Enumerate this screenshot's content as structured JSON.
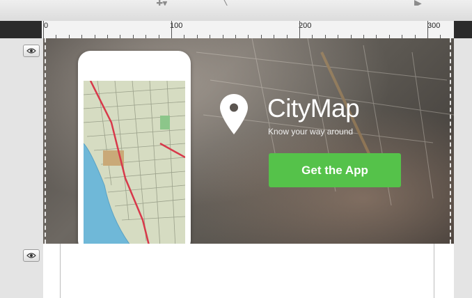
{
  "ruler": {
    "labels": [
      "0",
      "100",
      "200",
      "300"
    ]
  },
  "layers": [
    {
      "visibility_icon": "eye-icon"
    },
    {
      "visibility_icon": "eye-icon"
    }
  ],
  "banner": {
    "app_name": "CityMap",
    "tagline": "Know your way around",
    "cta_label": "Get the App",
    "pin_icon": "map-pin-icon",
    "colors": {
      "cta": "#55c24a",
      "text": "#ffffff"
    }
  }
}
